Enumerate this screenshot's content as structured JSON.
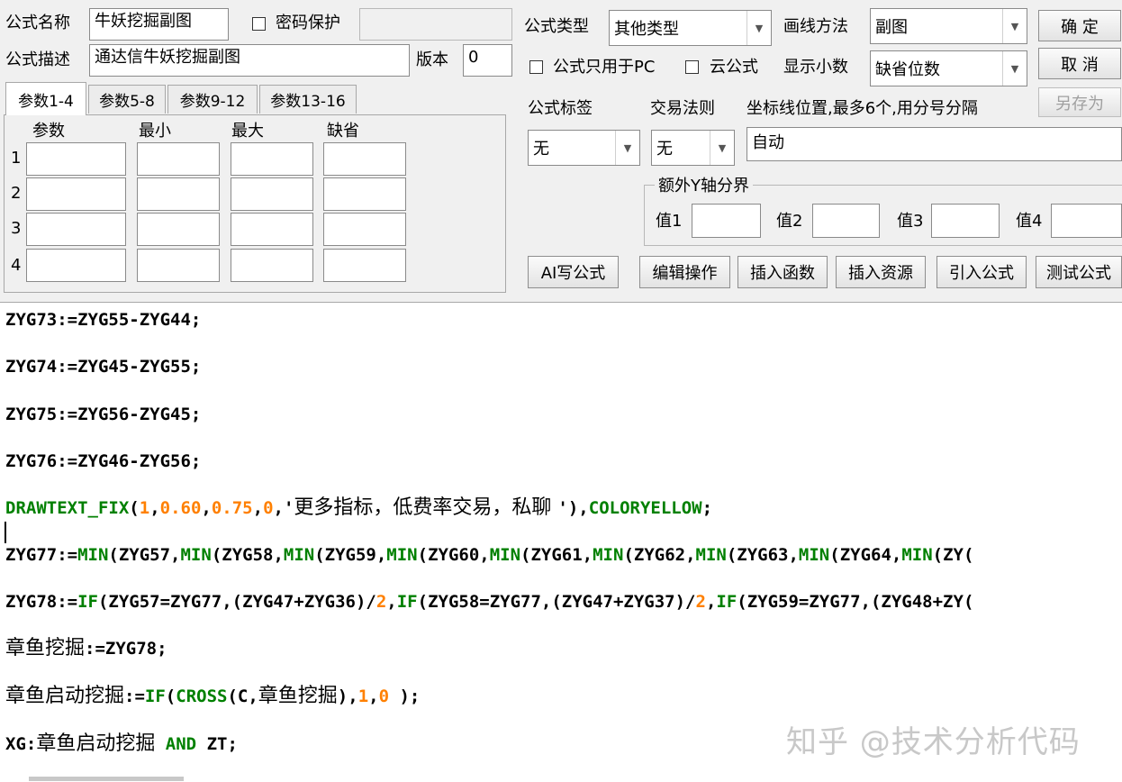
{
  "form": {
    "name_label": "公式名称",
    "name_value": "牛妖挖掘副图",
    "password_label": "密码保护",
    "desc_label": "公式描述",
    "desc_value": "通达信牛妖挖掘副图",
    "version_label": "版本",
    "version_value": "0",
    "type_label": "公式类型",
    "type_value": "其他类型",
    "draw_label": "画线方法",
    "draw_value": "副图",
    "pc_only_label": "公式只用于PC",
    "cloud_label": "云公式",
    "decimals_label": "显示小数",
    "decimals_value": "缺省位数",
    "tag_label": "公式标签",
    "tag_value": "无",
    "trade_label": "交易法则",
    "trade_value": "无",
    "axis_label": "坐标线位置,最多6个,用分号分隔",
    "axis_value": "自动",
    "yaxis_group_label": "额外Y轴分界",
    "yaxis_values": [
      "值1",
      "值2",
      "值3",
      "值4"
    ]
  },
  "buttons": {
    "ok": "确 定",
    "cancel": "取 消",
    "save_as": "另存为",
    "ai_write": "AI写公式",
    "edit_ops": "编辑操作",
    "insert_func": "插入函数",
    "insert_res": "插入资源",
    "import_formula": "引入公式",
    "test_formula": "测试公式"
  },
  "params": {
    "tabs": [
      "参数1-4",
      "参数5-8",
      "参数9-12",
      "参数13-16"
    ],
    "headers": [
      "参数",
      "最小",
      "最大",
      "缺省"
    ],
    "rows": [
      "1",
      "2",
      "3",
      "4"
    ]
  },
  "code": {
    "l1": "ZYG73:=ZYG55-ZYG44;",
    "l2": "ZYG74:=ZYG45-ZYG55;",
    "l3": "ZYG75:=ZYG56-ZYG45;",
    "l4": "ZYG76:=ZYG46-ZYG56;",
    "l5": {
      "fn": "DRAWTEXT_FIX",
      "p1": "(",
      "n1": "1",
      "p2": ",",
      "n2": "0.60",
      "p3": ",",
      "n3": "0.75",
      "p4": ",",
      "n4": "0",
      "p5": ",'",
      "text": "更多指标，低费率交易，私聊 ",
      "p6": "'),",
      "color": "COLORYELLOW",
      "p7": ";"
    },
    "l6": {
      "a": "ZYG77:=",
      "f1": "MIN",
      "b": "(ZYG57,",
      "f2": "MIN",
      "c": "(ZYG58,",
      "f3": "MIN",
      "d": "(ZYG59,",
      "f4": "MIN",
      "e": "(ZYG60,",
      "f5": "MIN",
      "f": "(ZYG61,",
      "f6": "MIN",
      "g": "(ZYG62,",
      "f7": "MIN",
      "h": "(ZYG63,",
      "f8": "MIN",
      "i": "(ZYG64,",
      "f9": "MIN",
      "j": "(ZY("
    },
    "l7": {
      "a": "ZYG78:=",
      "f1": "IF",
      "b": "(ZYG57=ZYG77,(ZYG47+ZYG36)/",
      "n1": "2",
      "c": ",",
      "f2": "IF",
      "d": "(ZYG58=ZYG77,(ZYG47+ZYG37)/",
      "n2": "2",
      "e": ",",
      "f3": "IF",
      "f": "(ZYG59=ZYG77,(ZYG48+ZY("
    },
    "l8": {
      "cn": "章鱼挖掘",
      "rest": ":=ZYG78;"
    },
    "l9": {
      "cn1": "章鱼启动挖掘",
      "a": ":=",
      "f1": "IF",
      "b": "(",
      "f2": "CROSS",
      "c": "(C,",
      "cn2": "章鱼挖掘",
      "d": "),",
      "n1": "1",
      "e": ",",
      "n2": "0",
      "f": " );"
    },
    "l10": {
      "a": "XG:",
      "cn": "章鱼启动挖掘",
      "sp": " ",
      "kw": "AND",
      "b": " ZT;"
    }
  },
  "watermark": "知乎 @技术分析代码"
}
